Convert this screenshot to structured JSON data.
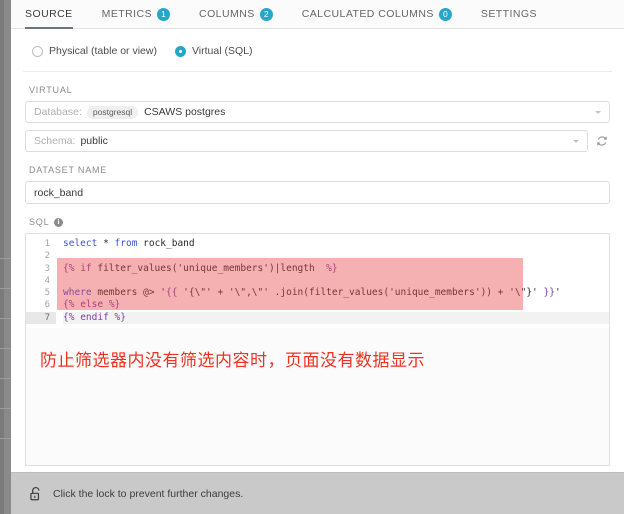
{
  "tabs": [
    {
      "label": "SOURCE",
      "badge": null,
      "active": true
    },
    {
      "label": "METRICS",
      "badge": "1",
      "active": false
    },
    {
      "label": "COLUMNS",
      "badge": "2",
      "active": false
    },
    {
      "label": "CALCULATED COLUMNS",
      "badge": "0",
      "active": false
    },
    {
      "label": "SETTINGS",
      "badge": null,
      "active": false
    }
  ],
  "source": {
    "radio_physical": "Physical (table or view)",
    "radio_virtual": "Virtual (SQL)",
    "selected": "virtual"
  },
  "virtual": {
    "section_label": "VIRTUAL",
    "database": {
      "lead": "Database:",
      "chip": "postgresql",
      "value": "CSAWS postgres"
    },
    "schema": {
      "lead": "Schema:",
      "value": "public"
    },
    "refresh_icon": "refresh-icon"
  },
  "dataset": {
    "section_label": "DATASET NAME",
    "value": "rock_band"
  },
  "sql": {
    "section_label": "SQL",
    "info_glyph": "i",
    "line_numbers": [
      "1",
      "2",
      "3",
      "4",
      "5",
      "6",
      "7"
    ],
    "current_line": 7,
    "lines": [
      "select * from rock_band",
      "",
      "{% if filter_values('unique_members')|length  %}",
      "",
      "where members @> '{{ '{\\\"' + '\\\",\\\"' .join(filter_values('unique_members')) + '\\\"}' }}'",
      "{% else %}",
      "{% endif %}"
    ]
  },
  "annotation": {
    "text": "防止筛选器内没有筛选内容时，页面没有数据显示",
    "color": "#ef3124"
  },
  "footer": {
    "lock_icon": "unlocked-lock-icon",
    "text": "Click the lock to prevent further changes."
  },
  "colors": {
    "accent": "#25a7c9",
    "highlight_overlay": "#e64646",
    "tab_underline": "#6b7280",
    "footer_bg": "#c9c9c9"
  }
}
